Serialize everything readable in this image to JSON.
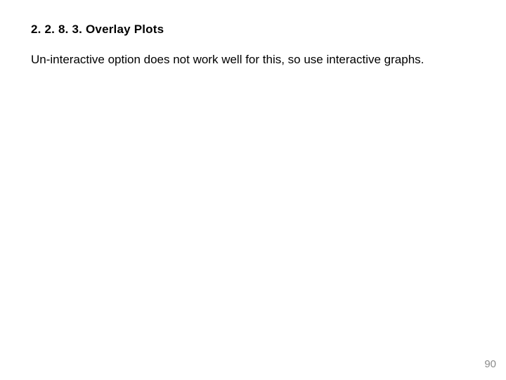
{
  "heading": "2. 2. 8. 3. Overlay Plots",
  "body": "Un-interactive option does not work well for this, so use interactive graphs.",
  "page_number": "90"
}
